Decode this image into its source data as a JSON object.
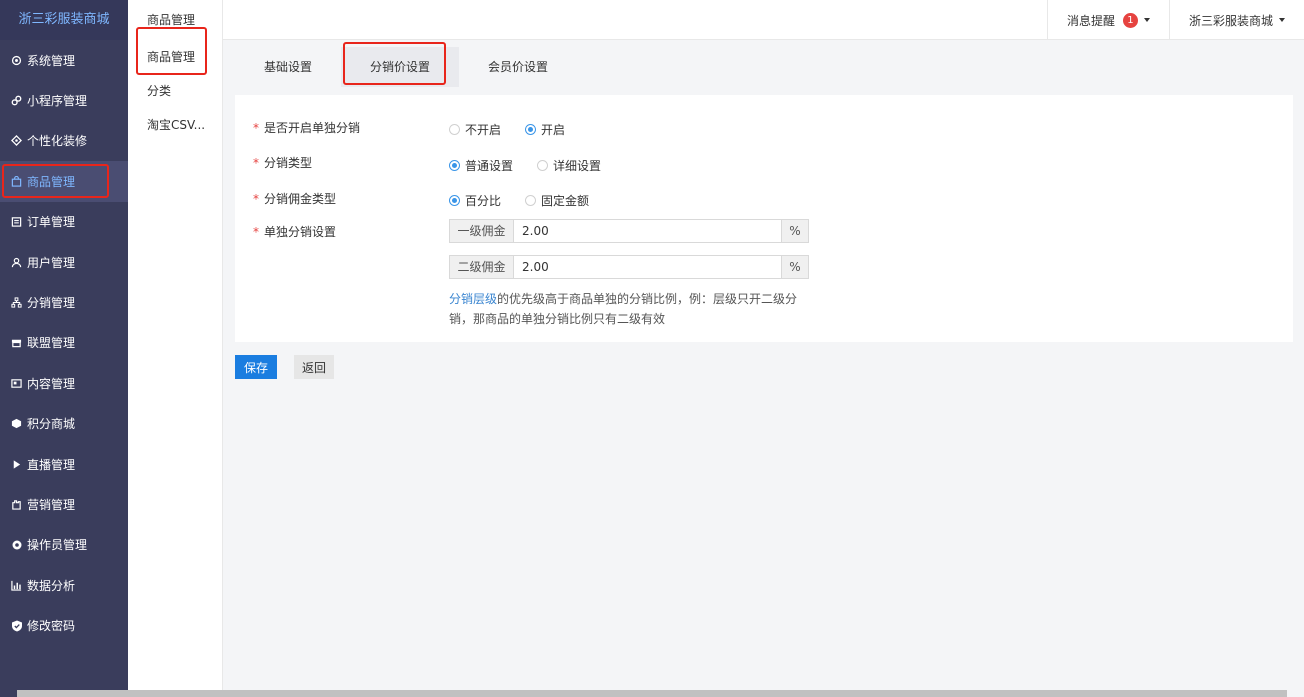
{
  "sidebar": {
    "brand": "浙三彩服装商城",
    "items": [
      {
        "label": "系统管理",
        "icon": "gear-icon"
      },
      {
        "label": "小程序管理",
        "icon": "link-icon"
      },
      {
        "label": "个性化装修",
        "icon": "layers-icon"
      },
      {
        "label": "商品管理",
        "icon": "bag-icon"
      },
      {
        "label": "订单管理",
        "icon": "calendar-icon"
      },
      {
        "label": "用户管理",
        "icon": "user-icon"
      },
      {
        "label": "分销管理",
        "icon": "sitemap-icon"
      },
      {
        "label": "联盟管理",
        "icon": "store-icon"
      },
      {
        "label": "内容管理",
        "icon": "content-icon"
      },
      {
        "label": "积分商城",
        "icon": "cube-icon"
      },
      {
        "label": "直播管理",
        "icon": "play-icon"
      },
      {
        "label": "营销管理",
        "icon": "hand-icon"
      },
      {
        "label": "操作员管理",
        "icon": "cog-icon"
      },
      {
        "label": "数据分析",
        "icon": "bar-chart-icon"
      },
      {
        "label": "修改密码",
        "icon": "shield-icon"
      }
    ]
  },
  "submenu": {
    "title": "商品管理",
    "items": [
      "商品管理",
      "分类",
      "淘宝CSV..."
    ]
  },
  "topbar": {
    "messages_label": "消息提醒",
    "messages_count": "1",
    "account_label": "浙三彩服装商城"
  },
  "tabs": [
    "基础设置",
    "分销价设置",
    "会员价设置"
  ],
  "form": {
    "separate_distribution": {
      "label": "是否开启单独分销",
      "options": [
        "不开启",
        "开启"
      ],
      "selected": "开启"
    },
    "distribution_type": {
      "label": "分销类型",
      "options": [
        "普通设置",
        "详细设置"
      ],
      "selected": "普通设置"
    },
    "commission_type": {
      "label": "分销佣金类型",
      "options": [
        "百分比",
        "固定金额"
      ],
      "selected": "百分比"
    },
    "separate_settings": {
      "label": "单独分销设置",
      "level1_label": "一级佣金",
      "level1_value": "2.00",
      "level2_label": "二级佣金",
      "level2_value": "2.00",
      "unit": "%"
    },
    "hint_link": "分销层级",
    "hint_text": "的优先级高于商品单独的分销比例，例：层级只开二级分销，那商品的单独分销比例只有二级有效"
  },
  "buttons": {
    "save": "保存",
    "back": "返回"
  },
  "colors": {
    "sidebar_bg": "#3a3d5c",
    "primary": "#1a7de0",
    "highlight": "#e8251b",
    "badge": "#e64340"
  }
}
